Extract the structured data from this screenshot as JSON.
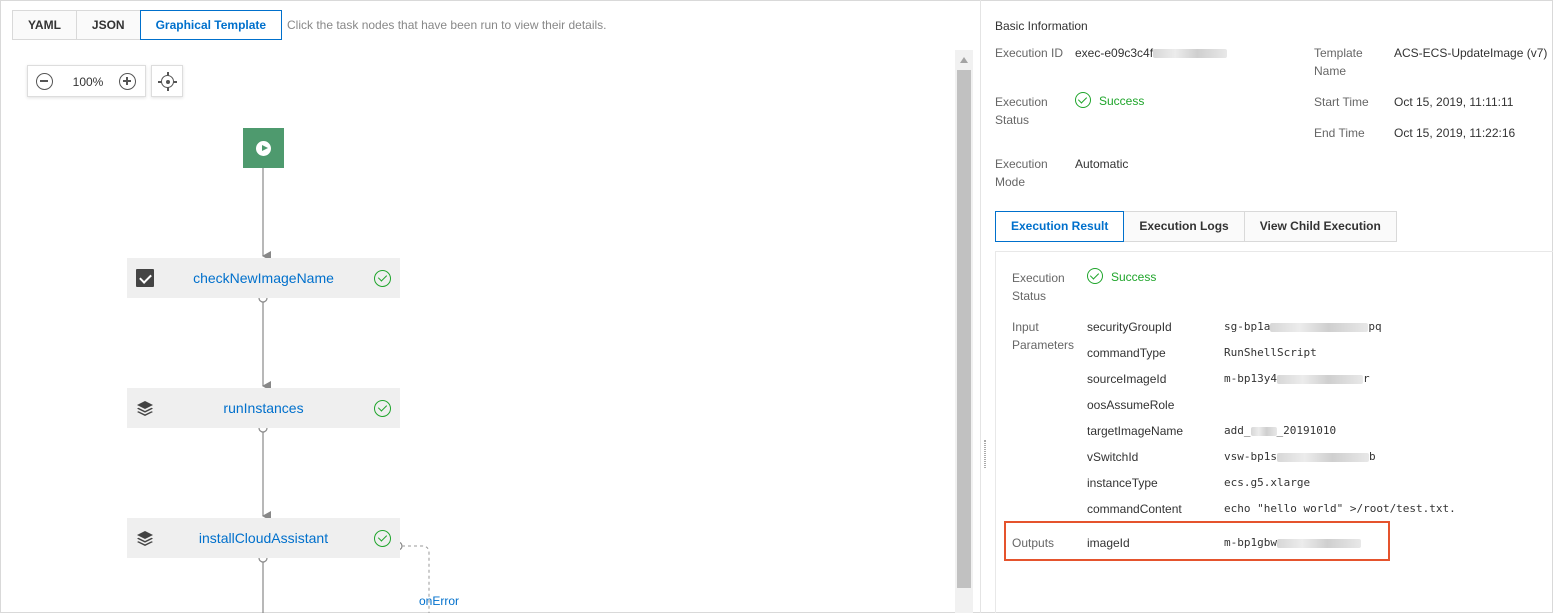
{
  "view_tabs": [
    "YAML",
    "JSON",
    "Graphical Template"
  ],
  "view_hint": "Click the task nodes that have been run to view their details.",
  "zoom_level": "100%",
  "flow": {
    "tasks": [
      {
        "name": "checkNewImageName",
        "icon": "checkbox-icon",
        "status": "success"
      },
      {
        "name": "runInstances",
        "icon": "layers-icon",
        "status": "success"
      },
      {
        "name": "installCloudAssistant",
        "icon": "layers-icon",
        "status": "success"
      }
    ],
    "on_error_label": "onError"
  },
  "basic_info": {
    "title": "Basic Information",
    "execution_id_label": "Execution ID",
    "execution_id_value": "exec-e09c3c4f",
    "template_name_label": "Template Name",
    "template_name_value": "ACS-ECS-UpdateImage (v7)",
    "execution_status_label": "Execution Status",
    "execution_status_value": "Success",
    "start_time_label": "Start Time",
    "start_time_value": "Oct 15, 2019, 11:11:11",
    "end_time_label": "End Time",
    "end_time_value": "Oct 15, 2019, 11:22:16",
    "execution_mode_label": "Execution Mode",
    "execution_mode_value": "Automatic"
  },
  "result_tabs": [
    "Execution Result",
    "Execution Logs",
    "View Child Execution"
  ],
  "result": {
    "status_label": "Execution Status",
    "status_value": "Success",
    "input_label": "Input Parameters",
    "params": [
      {
        "name": "securityGroupId",
        "value_start": "sg-bp1a",
        "value_end": "pq"
      },
      {
        "name": "commandType",
        "value_start": "RunShellScript",
        "value_end": ""
      },
      {
        "name": "sourceImageId",
        "value_start": "m-bp13y4",
        "value_end": "r"
      },
      {
        "name": "oosAssumeRole",
        "value_start": "",
        "value_end": ""
      },
      {
        "name": "targetImageName",
        "value_start": "add_",
        "value_end": "_20191010"
      },
      {
        "name": "vSwitchId",
        "value_start": "vsw-bp1s",
        "value_end": "b"
      },
      {
        "name": "instanceType",
        "value_start": "ecs.g5.xlarge",
        "value_end": ""
      },
      {
        "name": "commandContent",
        "value_start": "echo \"hello world\" >/root/test.txt.",
        "value_end": ""
      }
    ],
    "outputs_label": "Outputs",
    "output_name": "imageId",
    "output_value": "m-bp1gbw"
  },
  "colors": {
    "accent": "#0070cc",
    "success": "#1fa52b",
    "start_node": "#4e9a6e",
    "highlight": "#e5532d"
  }
}
